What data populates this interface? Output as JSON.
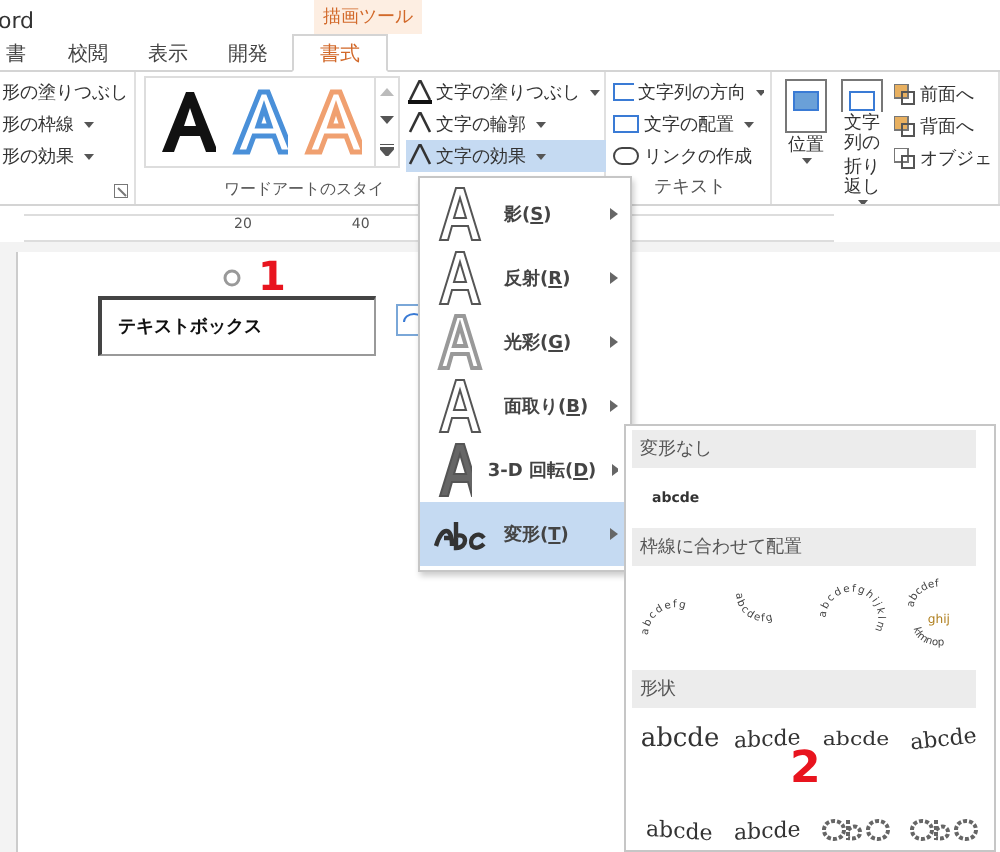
{
  "window": {
    "title": "ord",
    "context_label": "描画ツール"
  },
  "tabs": [
    {
      "label": "書",
      "selected": false
    },
    {
      "label": "校閲",
      "selected": false
    },
    {
      "label": "表示",
      "selected": false
    },
    {
      "label": "開発",
      "selected": false
    },
    {
      "label": "書式",
      "selected": true
    }
  ],
  "shape_styles": [
    "形の塗りつぶし",
    "形の枠線",
    "形の効果"
  ],
  "wordart_group": {
    "label": "ワードアートのスタイ",
    "gallery": [
      {
        "color": "#111111"
      },
      {
        "color": "#4a90d9"
      },
      {
        "color": "#f0a070"
      }
    ],
    "buttons": [
      {
        "label": "文字の塗りつぶし",
        "selected": false
      },
      {
        "label": "文字の輪郭",
        "selected": false
      },
      {
        "label": "文字の効果",
        "selected": true
      }
    ]
  },
  "text_group": {
    "label": "テキスト",
    "buttons": [
      {
        "label": "文字列の方向",
        "dropdown": true
      },
      {
        "label": "文字の配置",
        "dropdown": true
      },
      {
        "label": "リンクの作成",
        "dropdown": false
      }
    ]
  },
  "arrange_group": {
    "big_buttons": [
      {
        "lines": [
          "位置"
        ]
      },
      {
        "lines": [
          "文字列の",
          "折り返し"
        ]
      }
    ],
    "small_buttons": [
      "前面へ",
      "背面へ",
      "オブジェ"
    ]
  },
  "ruler": {
    "ticks": [
      "20",
      "40"
    ]
  },
  "textbox": {
    "text": "テキストボックス"
  },
  "annotations": [
    "1",
    "2"
  ],
  "effects_menu": [
    {
      "before": "影(",
      "key": "S",
      "after": ")",
      "kind": "shadow",
      "selected": false
    },
    {
      "before": "反射(",
      "key": "R",
      "after": ")",
      "kind": "reflection",
      "selected": false
    },
    {
      "before": "光彩(",
      "key": "G",
      "after": ")",
      "kind": "glow",
      "selected": false
    },
    {
      "before": "面取り(",
      "key": "B",
      "after": ")",
      "kind": "bevel",
      "selected": false
    },
    {
      "before": "3-D 回転(",
      "key": "D",
      "after": ")",
      "kind": "rotate3d",
      "selected": false
    },
    {
      "before": "変形(",
      "key": "T",
      "after": ")",
      "kind": "transform",
      "selected": true
    }
  ],
  "transform_menu": {
    "sections": [
      {
        "header": "変形なし",
        "kind": "plain",
        "samples": [
          "abcde"
        ]
      },
      {
        "header": "枠線に合わせて配置",
        "kind": "path",
        "paths": [
          {
            "kind": "arch-up",
            "lines": [
              "abcdefg"
            ]
          },
          {
            "kind": "arch-down",
            "lines": [
              "abcdefg"
            ]
          },
          {
            "kind": "circle",
            "lines": [
              "abcdefghijklm"
            ]
          },
          {
            "kind": "button",
            "lines": [
              "abcdef",
              "ghij",
              "klmnop"
            ]
          }
        ]
      },
      {
        "header": "形状",
        "kind": "shape",
        "shapes": [
          {
            "kind": "straight",
            "text": "abcde"
          },
          {
            "kind": "wave-small",
            "text": "abcde"
          },
          {
            "kind": "down",
            "text": "abcde"
          },
          {
            "kind": "up",
            "text": "abcde"
          },
          {
            "kind": "wave",
            "text": "abcde"
          },
          {
            "kind": "wave-small",
            "text": "abcde"
          },
          {
            "kind": "squeeze"
          },
          {
            "kind": "squeeze"
          }
        ]
      }
    ]
  }
}
